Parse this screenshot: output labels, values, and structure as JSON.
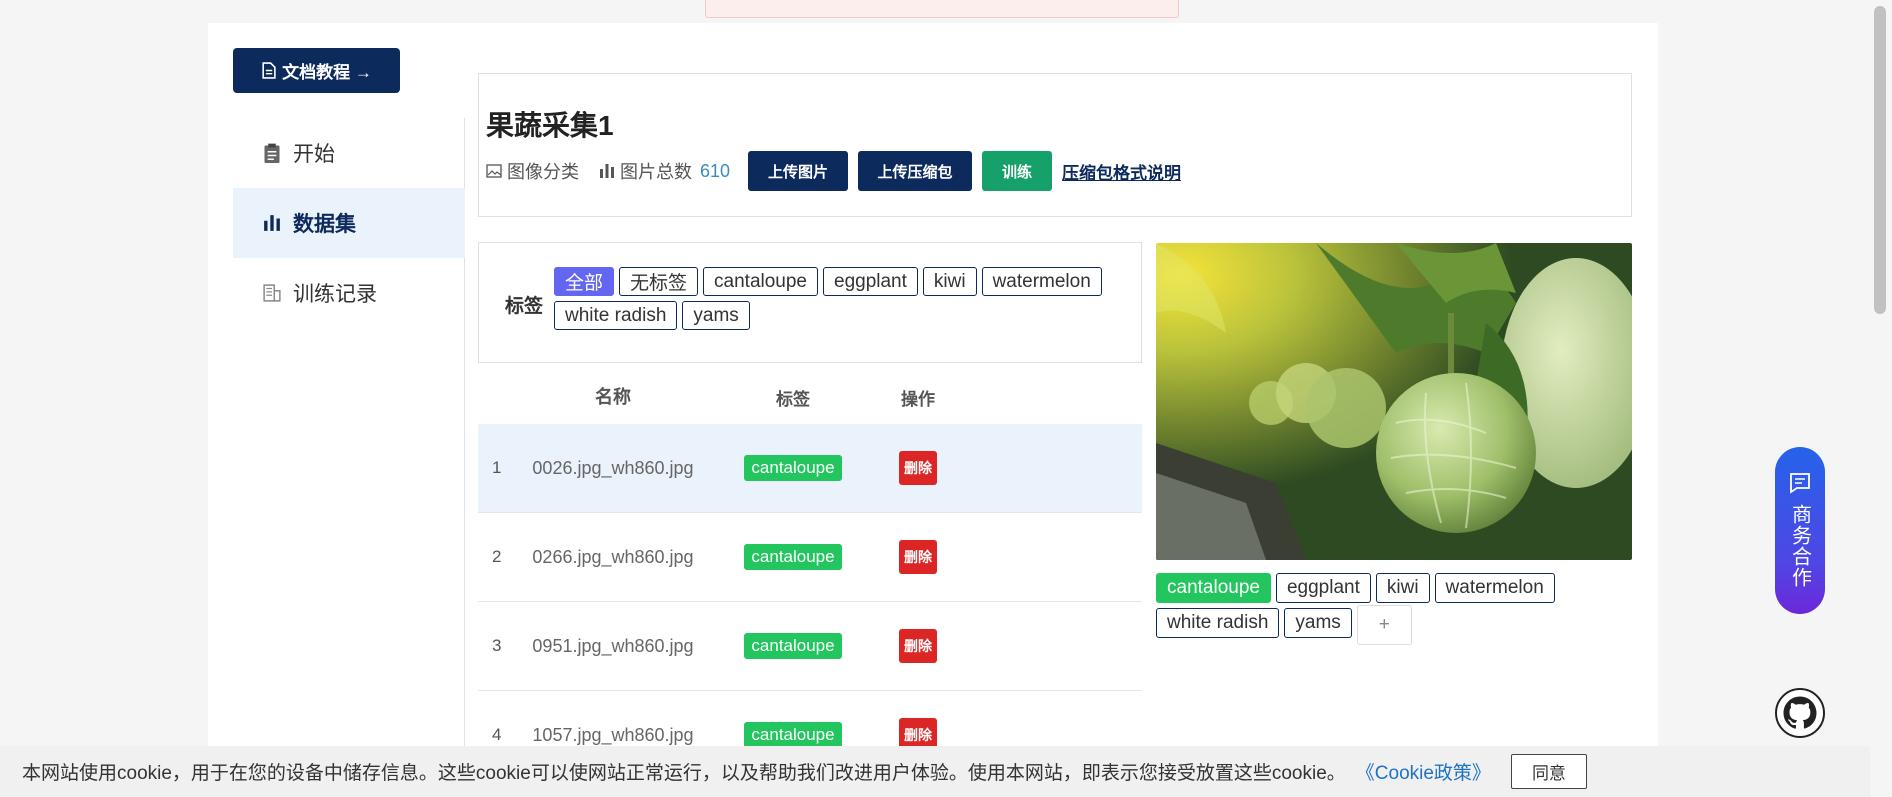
{
  "docs_button": {
    "label": "文档教程 →"
  },
  "sidebar": {
    "items": [
      {
        "label": "开始",
        "icon": "clipboard-icon"
      },
      {
        "label": "数据集",
        "icon": "bar-chart-icon",
        "active": true
      },
      {
        "label": "训练记录",
        "icon": "document-icon"
      }
    ]
  },
  "dataset": {
    "title": "果蔬采集1",
    "type_label": "图像分类",
    "count_label": "图片总数",
    "count": "610",
    "upload_image": "上传图片",
    "upload_zip": "上传压缩包",
    "train": "训练",
    "zip_format_link": "压缩包格式说明"
  },
  "tags": {
    "label": "标签",
    "items": [
      "全部",
      "无标签",
      "cantaloupe",
      "eggplant",
      "kiwi",
      "watermelon",
      "white radish",
      "yams"
    ]
  },
  "table": {
    "headers": {
      "name": "名称",
      "label": "标签",
      "action": "操作"
    },
    "rows": [
      {
        "index": "1",
        "name": "0026.jpg_wh860.jpg",
        "label": "cantaloupe",
        "action": "删除"
      },
      {
        "index": "2",
        "name": "0266.jpg_wh860.jpg",
        "label": "cantaloupe",
        "action": "删除"
      },
      {
        "index": "3",
        "name": "0951.jpg_wh860.jpg",
        "label": "cantaloupe",
        "action": "删除"
      },
      {
        "index": "4",
        "name": "1057.jpg_wh860.jpg",
        "label": "cantaloupe",
        "action": "删除"
      }
    ]
  },
  "preview": {
    "tags": [
      "cantaloupe",
      "eggplant",
      "kiwi",
      "watermelon",
      "white radish",
      "yams"
    ],
    "add": "+"
  },
  "business": {
    "label": "商务合作"
  },
  "cookie": {
    "text": "本网站使用cookie，用于在您的设备中储存信息。这些cookie可以使网站正常运行，以及帮助我们改进用户体验。使用本网站，即表示您接受放置这些cookie。",
    "policy_link": "《Cookie政策》",
    "agree": "同意"
  },
  "colors": {
    "navy": "#0d2a5c",
    "green": "#22c55e",
    "train_green": "#16a06a",
    "delete_red": "#dc2626",
    "active_tag": "#6366f1"
  }
}
